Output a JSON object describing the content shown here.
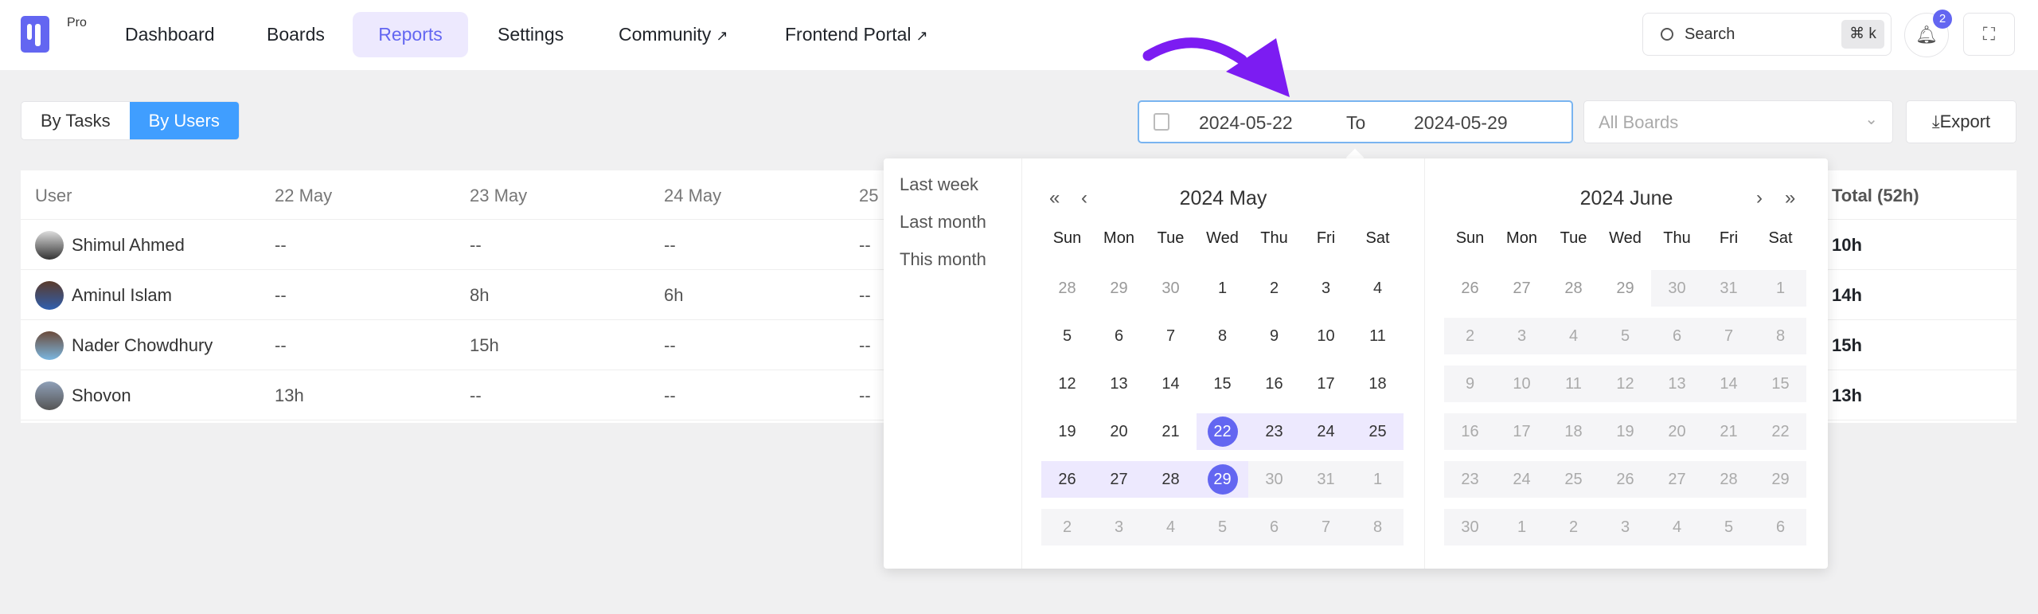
{
  "app": {
    "logo_badge": "Pro",
    "accent": "#6366f1"
  },
  "nav": [
    {
      "label": "Dashboard"
    },
    {
      "label": "Boards"
    },
    {
      "label": "Reports",
      "active": true
    },
    {
      "label": "Settings"
    },
    {
      "label": "Community",
      "external": true
    },
    {
      "label": "Frontend Portal",
      "external": true
    }
  ],
  "external_icon": "↗",
  "search": {
    "label": "Search",
    "shortcut": "⌘ k"
  },
  "notifications": {
    "count": "2"
  },
  "view_toggle": {
    "options": [
      "By Tasks",
      "By Users"
    ],
    "selected": "By Users"
  },
  "date_range": {
    "start": "2024-05-22",
    "separator": "To",
    "end": "2024-05-29"
  },
  "boards_select": {
    "placeholder": "All Boards"
  },
  "export_label": "Export",
  "table": {
    "columns": [
      "User",
      "22 May",
      "23 May",
      "24 May",
      "25",
      "Total (52h)"
    ],
    "rows": [
      {
        "user": "Shimul Ahmed",
        "cells": [
          "--",
          "--",
          "--",
          "--"
        ],
        "total": "10h"
      },
      {
        "user": "Aminul Islam",
        "cells": [
          "--",
          "8h",
          "6h",
          "--"
        ],
        "total": "14h"
      },
      {
        "user": "Nader Chowdhury",
        "cells": [
          "--",
          "15h",
          "--",
          "--"
        ],
        "total": "15h"
      },
      {
        "user": "Shovon",
        "cells": [
          "13h",
          "--",
          "--",
          "--"
        ],
        "total": "13h"
      }
    ]
  },
  "picker": {
    "shortcuts": [
      "Last week",
      "Last month",
      "This month"
    ],
    "weekdays": [
      "Sun",
      "Mon",
      "Tue",
      "Wed",
      "Thu",
      "Fri",
      "Sat"
    ],
    "left_title": "2024 May",
    "right_title": "2024 June",
    "prev_year": "«",
    "prev_month": "‹",
    "next_month": "›",
    "next_year": "»",
    "left_days": [
      "28",
      "29",
      "30",
      "1",
      "2",
      "3",
      "4",
      "5",
      "6",
      "7",
      "8",
      "9",
      "10",
      "11",
      "12",
      "13",
      "14",
      "15",
      "16",
      "17",
      "18",
      "19",
      "20",
      "21",
      "22",
      "23",
      "24",
      "25",
      "26",
      "27",
      "28",
      "29",
      "30",
      "31",
      "1",
      "2",
      "3",
      "4",
      "5",
      "6",
      "7",
      "8"
    ],
    "right_days": [
      "26",
      "27",
      "28",
      "29",
      "30",
      "31",
      "1",
      "2",
      "3",
      "4",
      "5",
      "6",
      "7",
      "8",
      "9",
      "10",
      "11",
      "12",
      "13",
      "14",
      "15",
      "16",
      "17",
      "18",
      "19",
      "20",
      "21",
      "22",
      "23",
      "24",
      "25",
      "26",
      "27",
      "28",
      "29",
      "30",
      "1",
      "2",
      "3",
      "4",
      "5",
      "6"
    ],
    "range_start": "22",
    "range_end": "29"
  }
}
